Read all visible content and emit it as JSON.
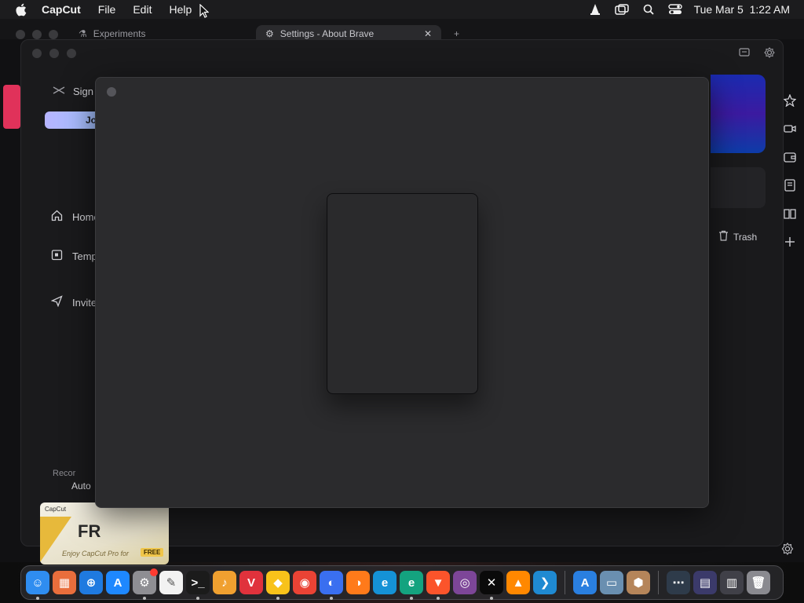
{
  "menubar": {
    "app_name": "CapCut",
    "menus": [
      "File",
      "Edit",
      "Help"
    ],
    "datetime": "Tue Mar 5  1:22 AM"
  },
  "browser": {
    "tabs": [
      {
        "label": "Experiments",
        "active": false
      },
      {
        "label": "Settings - About Brave",
        "active": true
      }
    ],
    "accent": "#e0325a"
  },
  "capcut": {
    "sidebar": {
      "sign_label": "Sign",
      "join_label": "Jo",
      "nav": [
        "Home",
        "Temp",
        "Invite"
      ],
      "promo_label": "Recor",
      "promo_auto": "Auto",
      "promo_card": {
        "brand": "CapCut",
        "headline": "FR",
        "tagline": "Enjoy CapCut Pro for",
        "free": "FREE"
      }
    },
    "trash_label": "Trash"
  },
  "modal": {
    "visible": true
  },
  "dock": {
    "apps": [
      {
        "name": "finder",
        "color": "#2f8df0",
        "glyph": "☺",
        "running": true
      },
      {
        "name": "launchpad",
        "color": "#e96e3c",
        "glyph": "▦",
        "running": false
      },
      {
        "name": "safari",
        "color": "#1f7ae0",
        "glyph": "⊕",
        "running": false
      },
      {
        "name": "app-store",
        "color": "#1e88ff",
        "glyph": "A",
        "running": false
      },
      {
        "name": "system-settings",
        "color": "#8e8e93",
        "glyph": "⚙",
        "running": true,
        "badge": true
      },
      {
        "name": "textedit",
        "color": "#f2f2f2",
        "glyph": "✎",
        "running": false
      },
      {
        "name": "terminal",
        "color": "#1b1b1b",
        "glyph": ">_",
        "running": true
      },
      {
        "name": "garageband",
        "color": "#f0a030",
        "glyph": "♪",
        "running": false
      },
      {
        "name": "vivaldi",
        "color": "#e0323c",
        "glyph": "V",
        "running": false
      },
      {
        "name": "sketch",
        "color": "#f8c21a",
        "glyph": "◆",
        "running": true
      },
      {
        "name": "chrome",
        "color": "#ea4335",
        "glyph": "◉",
        "running": false
      },
      {
        "name": "firefox-dev",
        "color": "#3a6ff0",
        "glyph": "◐",
        "running": true
      },
      {
        "name": "firefox",
        "color": "#ff7a1a",
        "glyph": "◑",
        "running": false
      },
      {
        "name": "edge",
        "color": "#1592d6",
        "glyph": "e",
        "running": false
      },
      {
        "name": "edge-canary",
        "color": "#14a37f",
        "glyph": "e",
        "running": true
      },
      {
        "name": "brave",
        "color": "#fb542b",
        "glyph": "▼",
        "running": true
      },
      {
        "name": "tor-browser",
        "color": "#7d4698",
        "glyph": "◎",
        "running": false
      },
      {
        "name": "capcut",
        "color": "#0a0a0a",
        "glyph": "✕",
        "running": true
      },
      {
        "name": "vlc",
        "color": "#ff8800",
        "glyph": "▲",
        "running": false
      },
      {
        "name": "vscode",
        "color": "#1f8ad2",
        "glyph": "❯",
        "running": false
      },
      {
        "name": "xcode-instruments",
        "color": "#2a7fe0",
        "glyph": "A",
        "running": false
      },
      {
        "name": "preview",
        "color": "#6a8fb0",
        "glyph": "▭",
        "running": false
      },
      {
        "name": "package-installer",
        "color": "#b5855a",
        "glyph": "⬢",
        "running": false
      },
      {
        "name": "downloads-stack",
        "color": "#2e3b4a",
        "glyph": "⋯",
        "running": false
      },
      {
        "name": "window-stack-1",
        "color": "#3b3a6a",
        "glyph": "▤",
        "running": false
      },
      {
        "name": "window-stack-2",
        "color": "#404048",
        "glyph": "▥",
        "running": false
      },
      {
        "name": "trash",
        "color": "#8a8a90",
        "glyph": "🗑",
        "running": false
      }
    ]
  }
}
